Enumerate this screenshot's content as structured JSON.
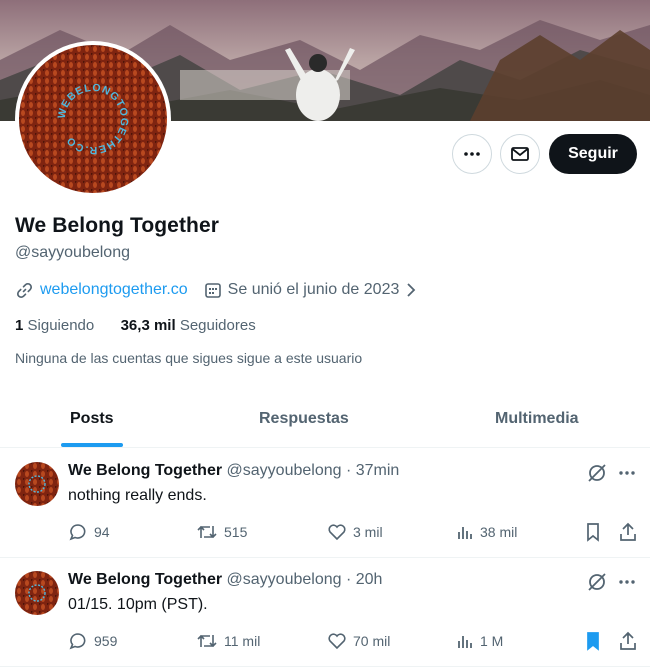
{
  "profile": {
    "name": "We Belong Together",
    "handle": "@sayyoubelong",
    "website": "webelongtogether.co",
    "joined": "Se unió el junio de 2023",
    "following_count": "1",
    "following_label": "Siguiendo",
    "followers_count": "36,3 mil",
    "followers_label": "Seguidores",
    "mutual_note": "Ninguna de las cuentas que sigues sigue a este usuario",
    "avatar_text": "WEBELONGTOGETHER.CO"
  },
  "actions": {
    "follow_label": "Seguir",
    "more_icon": "more-icon",
    "message_icon": "envelope-icon"
  },
  "tabs": [
    {
      "label": "Posts",
      "active": true
    },
    {
      "label": "Respuestas",
      "active": false
    },
    {
      "label": "Multimedia",
      "active": false
    }
  ],
  "posts": [
    {
      "name": "We Belong Together",
      "handle": "@sayyoubelong",
      "separator": "·",
      "time": "37min",
      "text": "nothing really ends.",
      "replies": "94",
      "reposts": "515",
      "likes": "3 mil",
      "views": "38 mil",
      "bookmarked": false
    },
    {
      "name": "We Belong Together",
      "handle": "@sayyoubelong",
      "separator": "·",
      "time": "20h",
      "text": "01/15. 10pm (PST).",
      "replies": "959",
      "reposts": "11 mil",
      "likes": "70 mil",
      "views": "1 M",
      "bookmarked": true
    }
  ],
  "colors": {
    "accent": "#1d9bf0",
    "text": "#0f1419",
    "muted": "#536471",
    "avatar_bg": "#8a2a10"
  }
}
